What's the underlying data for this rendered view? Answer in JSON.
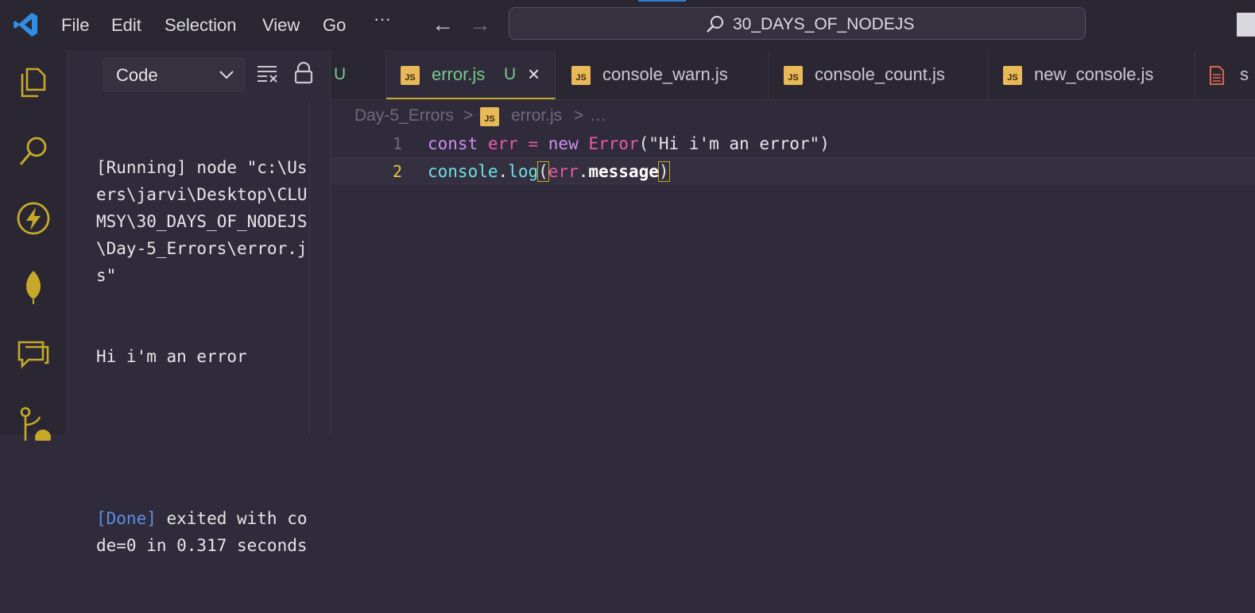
{
  "titlebar": {
    "menu": [
      "File",
      "Edit",
      "Selection",
      "View",
      "Go",
      "···"
    ],
    "search_text": "30_DAYS_OF_NODEJS"
  },
  "activity_bar": [
    "explorer-icon",
    "search-icon",
    "lightning-icon",
    "leaf-icon",
    "chat-icon",
    "source-control-icon"
  ],
  "output_panel": {
    "selector_value": "Code",
    "running_line": "[Running] node \"c:\\Users\\jarvi\\Desktop\\CLUMSY\\30_DAYS_OF_NODEJS\\Day-5_Errors\\error.js\"",
    "result_line": "Hi i'm an error",
    "done_tag": "[Done]",
    "done_text": " exited with code=0 in 0.317 seconds"
  },
  "tabs": [
    {
      "label": "U",
      "status": ""
    },
    {
      "label": "error.js",
      "status": "U",
      "badge": "JS",
      "active": true
    },
    {
      "label": "console_warn.js",
      "badge": "JS"
    },
    {
      "label": "console_count.js",
      "badge": "JS"
    },
    {
      "label": "new_console.js",
      "badge": "JS"
    },
    {
      "label": "s",
      "badge": ""
    }
  ],
  "breadcrumb": {
    "folder": "Day-5_Errors",
    "file": "error.js",
    "more": "…",
    "sep": ">"
  },
  "editor": {
    "line_numbers": [
      "1",
      "2"
    ],
    "line1": {
      "kw1": "const",
      "var": "err",
      "eq": "=",
      "kw2": "new",
      "cls": "Error",
      "lp": "(",
      "str": "\"Hi i'm an error\"",
      "rp": ")"
    },
    "line2": {
      "obj": "console",
      "dot1": ".",
      "fn": "log",
      "lp": "(",
      "arg": "err",
      "dot2": ".",
      "prop": "message",
      "rp": ")"
    }
  },
  "colors": {
    "background": "#2f2b3a",
    "accent_tab_border": "#c7a92a",
    "untracked_green": "#7ac88b",
    "js_badge": "#e9b857",
    "icon_gold": "#c7a92a"
  }
}
